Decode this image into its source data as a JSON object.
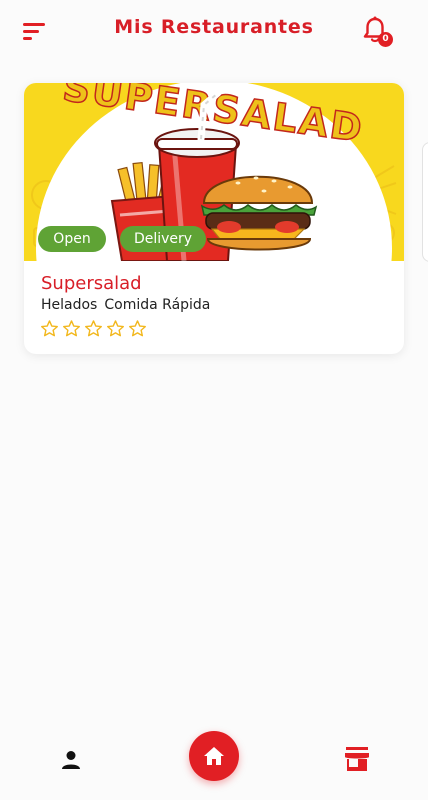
{
  "theme": {
    "accent": "#e11f24",
    "title_color": "#d81e27",
    "tag_green": "#5fa335",
    "star_color": "#f2b81f",
    "banner_yellow": "#f8d81e"
  },
  "header": {
    "menu_icon": "sort-menu-icon",
    "title": "Mis Restaurantes",
    "notification_icon": "bell-icon",
    "notification_count": "0"
  },
  "restaurants": [
    {
      "banner_text": "SUPERSALAD",
      "tags": [
        "Open",
        "Delivery"
      ],
      "name": "Supersalad",
      "categories": [
        "Helados",
        "Comida Rápida"
      ],
      "rating": 0,
      "max_rating": 5
    }
  ],
  "bottom_nav": {
    "items": [
      {
        "icon": "person-icon"
      },
      {
        "icon": "home-icon",
        "active": true
      },
      {
        "icon": "store-icon"
      }
    ]
  }
}
